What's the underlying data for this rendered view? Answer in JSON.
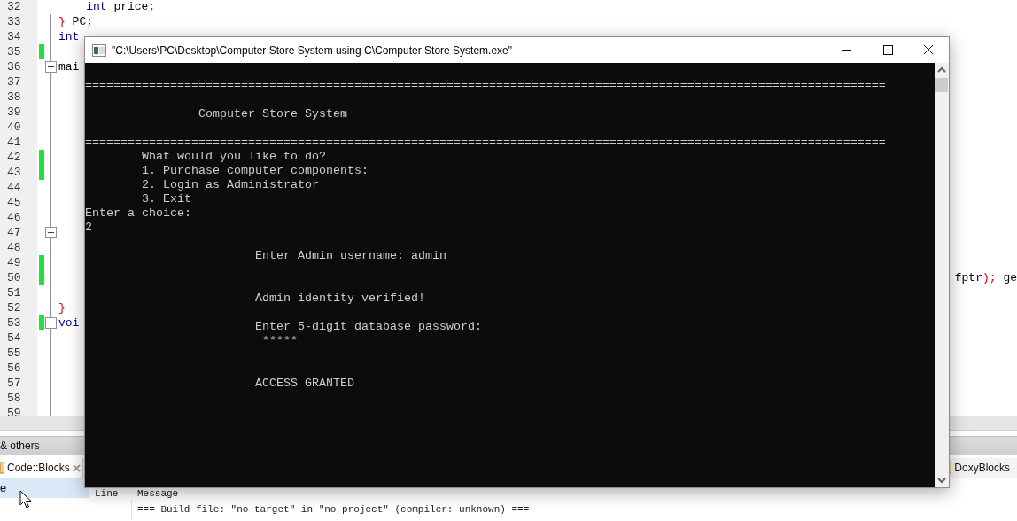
{
  "editor": {
    "lines": [
      {
        "number": "32",
        "kind": "inner",
        "changed": false,
        "collapsible": false,
        "tokens": [
          {
            "kind": "keyword",
            "text": "int"
          },
          {
            "kind": "plain",
            "text": " price"
          },
          {
            "kind": "punct",
            "text": ";"
          }
        ]
      },
      {
        "number": "33",
        "kind": "top",
        "changed": false,
        "collapsible": false,
        "tokens": [
          {
            "kind": "punct",
            "text": "}"
          },
          {
            "kind": "plain",
            "text": " PC"
          },
          {
            "kind": "punct",
            "text": ";"
          }
        ]
      },
      {
        "number": "34",
        "kind": "top",
        "changed": false,
        "collapsible": false,
        "tokens": [
          {
            "kind": "keyword",
            "text": "int"
          }
        ]
      },
      {
        "number": "35",
        "kind": "top",
        "changed": true,
        "collapsible": false
      },
      {
        "number": "36",
        "kind": "top",
        "changed": false,
        "collapsible": true,
        "tokens": [
          {
            "kind": "plain",
            "text": "mai"
          }
        ]
      },
      {
        "number": "37",
        "kind": "top",
        "changed": false,
        "collapsible": false
      },
      {
        "number": "38",
        "kind": "top",
        "changed": false,
        "collapsible": false
      },
      {
        "number": "39",
        "kind": "top",
        "changed": false,
        "collapsible": false
      },
      {
        "number": "40",
        "kind": "top",
        "changed": false,
        "collapsible": false
      },
      {
        "number": "41",
        "kind": "top",
        "changed": false,
        "collapsible": false
      },
      {
        "number": "42",
        "kind": "top",
        "changed": true,
        "collapsible": false
      },
      {
        "number": "43",
        "kind": "top",
        "changed": true,
        "collapsible": false
      },
      {
        "number": "44",
        "kind": "top",
        "changed": false,
        "collapsible": false
      },
      {
        "number": "45",
        "kind": "top",
        "changed": false,
        "collapsible": false
      },
      {
        "number": "46",
        "kind": "top",
        "changed": false,
        "collapsible": false
      },
      {
        "number": "47",
        "kind": "top",
        "changed": false,
        "collapsible": true
      },
      {
        "number": "48",
        "kind": "top",
        "changed": false,
        "collapsible": false
      },
      {
        "number": "49",
        "kind": "top",
        "changed": true,
        "collapsible": false
      },
      {
        "number": "50",
        "kind": "top",
        "changed": true,
        "collapsible": false,
        "tail": [
          {
            "kind": "plain",
            "text": "fptr"
          },
          {
            "kind": "punct",
            "text": ");"
          },
          {
            "kind": "plain",
            "text": " ge"
          }
        ]
      },
      {
        "number": "51",
        "kind": "top",
        "changed": false,
        "collapsible": false
      },
      {
        "number": "52",
        "kind": "top",
        "changed": false,
        "collapsible": false,
        "tokens": [
          {
            "kind": "punct",
            "text": "}"
          }
        ]
      },
      {
        "number": "53",
        "kind": "top",
        "changed": true,
        "collapsible": true,
        "tokens": [
          {
            "kind": "keyword",
            "text": "voi"
          }
        ]
      },
      {
        "number": "54",
        "kind": "top",
        "changed": false,
        "collapsible": false
      },
      {
        "number": "55",
        "kind": "top",
        "changed": false,
        "collapsible": false
      },
      {
        "number": "56",
        "kind": "top",
        "changed": false,
        "collapsible": false
      },
      {
        "number": "57",
        "kind": "top",
        "changed": false,
        "collapsible": false
      },
      {
        "number": "58",
        "kind": "top",
        "changed": false,
        "collapsible": false
      },
      {
        "number": "59",
        "kind": "top",
        "changed": false,
        "collapsible": false
      }
    ]
  },
  "logs_panel": {
    "title": "& others",
    "tabs": [
      {
        "label": "Code::Blocks",
        "selected": true,
        "closable": true
      },
      {
        "label": "DoxyBlocks",
        "selected": false,
        "closable": false
      }
    ],
    "list": [
      {
        "label": "e",
        "selected": true
      }
    ],
    "columns": [
      "Line",
      "Message"
    ],
    "rows": [
      {
        "message": "=== Build file: \"no target\" in \"no project\" (compiler: unknown) ==="
      }
    ]
  },
  "console": {
    "title": "\"C:\\Users\\PC\\Desktop\\Computer Store System using C\\Computer Store System.exe\"",
    "lines": [
      {
        "kind": "rule",
        "text": "================================================================================================================="
      },
      {
        "kind": "blank"
      },
      {
        "kind": "title",
        "text": "Computer Store System"
      },
      {
        "kind": "blank"
      },
      {
        "kind": "rule",
        "text": "================================================================================================================="
      },
      {
        "kind": "menu",
        "text": "What would you like to do?"
      },
      {
        "kind": "menu",
        "text": "1. Purchase computer components:"
      },
      {
        "kind": "menu",
        "text": "2. Login as Administrator"
      },
      {
        "kind": "menu",
        "text": "3. Exit"
      },
      {
        "kind": "flush",
        "text": "Enter a choice:"
      },
      {
        "kind": "flush",
        "text": "2"
      },
      {
        "kind": "blank"
      },
      {
        "kind": "detail",
        "text": "Enter Admin username: admin"
      },
      {
        "kind": "blank"
      },
      {
        "kind": "blank"
      },
      {
        "kind": "detail",
        "text": "Admin identity verified!"
      },
      {
        "kind": "blank"
      },
      {
        "kind": "detail",
        "text": "Enter 5-digit database password:"
      },
      {
        "kind": "mask",
        "text": "*****"
      },
      {
        "kind": "blank"
      },
      {
        "kind": "blank"
      },
      {
        "kind": "detail",
        "text": "ACCESS GRANTED"
      }
    ]
  }
}
